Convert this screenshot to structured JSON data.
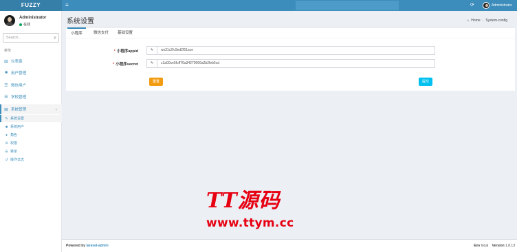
{
  "app": {
    "logo": "FUZZY"
  },
  "topbar": {
    "menu_icon": "hamburger-icon",
    "refresh_icon": "refresh-icon",
    "user_name": "Administrator"
  },
  "sidebar": {
    "user": {
      "name": "Administrator",
      "status": "在线"
    },
    "search_placeholder": "Search...",
    "header": "菜单",
    "items": [
      {
        "label": "仪表盘",
        "icon": "chart-icon"
      },
      {
        "label": "用户管理",
        "icon": "users-icon"
      },
      {
        "label": "微信用户",
        "icon": "list-icon"
      },
      {
        "label": "学校管理",
        "icon": "list-icon"
      },
      {
        "label": "系统管理",
        "icon": "tasks-icon"
      }
    ],
    "sub_items": [
      {
        "label": "系统设置",
        "icon": "wrench-icon"
      },
      {
        "label": "系统用户",
        "icon": "users-icon"
      },
      {
        "label": "角色",
        "icon": "user-icon"
      },
      {
        "label": "权限",
        "icon": "ban-icon"
      },
      {
        "label": "菜单",
        "icon": "bars-icon"
      },
      {
        "label": "操作日志",
        "icon": "history-icon"
      }
    ]
  },
  "content": {
    "title": "系统设置",
    "breadcrumb": {
      "home": "Home",
      "current": "System-config"
    },
    "tabs": [
      "小程序",
      "微信支付",
      "基础设置"
    ],
    "fields": [
      {
        "label": "小程序appid",
        "value": "wx31c2fc9ed2f51ace"
      },
      {
        "label": "小程序secret",
        "value": "c1a00ce5fcff76a34270066a2b2feb6cd"
      }
    ],
    "reset_label": "重置",
    "submit_label": "提交"
  },
  "watermark": {
    "line1": "TT源码",
    "line2": "www.ttym.cc"
  },
  "footer": {
    "powered_prefix": "Powered by",
    "powered_link": "laravel-admin",
    "env_label": "Env",
    "env_value": "local",
    "version_label": "Version",
    "version_value": "1.8.13"
  },
  "colors": {
    "primary": "#3c8dbc",
    "logo_bg": "#367fa9",
    "warning": "#f39c12",
    "info": "#00c0ef",
    "watermark": "#e60012"
  }
}
